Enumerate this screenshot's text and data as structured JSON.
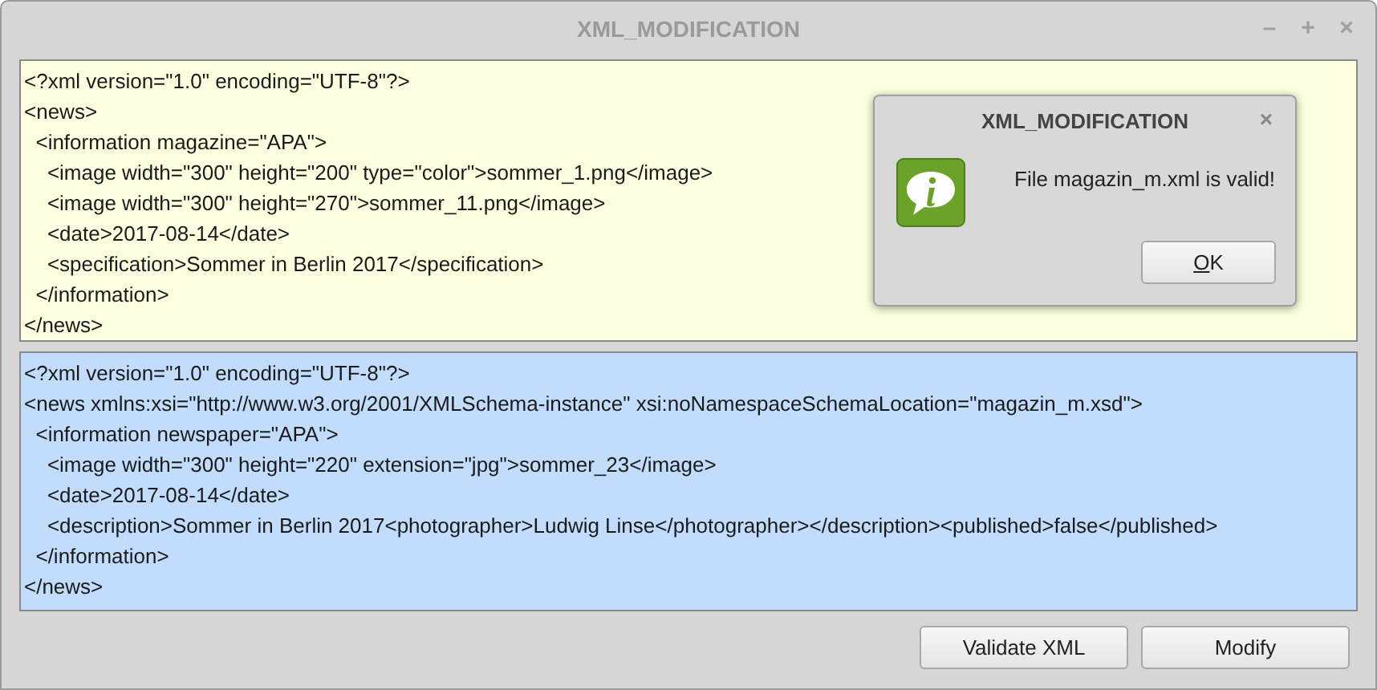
{
  "window": {
    "title": "XML_MODIFICATION",
    "controls": [
      "–",
      "+",
      "×"
    ]
  },
  "source_editor": {
    "lines": [
      "<?xml version=\"1.0\" encoding=\"UTF-8\"?>",
      "<news>",
      "  <information magazine=\"APA\">",
      "    <image width=\"300\" height=\"200\" type=\"color\">sommer_1.png</image>",
      "    <image width=\"300\" height=\"270\">sommer_11.png</image>",
      "    <date>2017-08-14</date>",
      "    <specification>Sommer in Berlin 2017</specification>",
      "  </information>",
      "</news>"
    ]
  },
  "result_editor": {
    "lines": [
      "<?xml version=\"1.0\" encoding=\"UTF-8\"?>",
      "<news xmlns:xsi=\"http://www.w3.org/2001/XMLSchema-instance\" xsi:noNamespaceSchemaLocation=\"magazin_m.xsd\">",
      "  <information newspaper=\"APA\">",
      "    <image width=\"300\" height=\"220\" extension=\"jpg\">sommer_23</image>",
      "    <date>2017-08-14</date>",
      "    <description>Sommer in Berlin 2017<photographer>Ludwig Linse</photographer></description><published>false</published>",
      "  </information>",
      "</news>"
    ]
  },
  "buttons": [
    "Validate XML",
    "Modify"
  ],
  "dialog": {
    "title": "XML_MODIFICATION",
    "close": "×",
    "message": "File magazin_m.xml is valid!",
    "button": {
      "label": "OK",
      "mnemonic_shown": true
    }
  }
}
